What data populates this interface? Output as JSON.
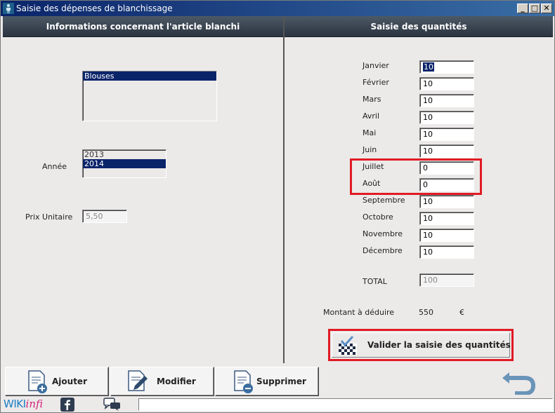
{
  "window": {
    "title": "Saisie des dépenses de blanchissage",
    "min_glyph": "_",
    "max_glyph": "□",
    "close_glyph": "✕"
  },
  "left_panel": {
    "header": "Informations concernant l'article blanchi",
    "article_list": [
      "Blouses"
    ],
    "article_selected": "Blouses",
    "annee_label": "Année",
    "annee_list": [
      "2013",
      "2014"
    ],
    "annee_selected": "2014",
    "prix_label": "Prix Unitaire",
    "prix_value": "5,50"
  },
  "right_panel": {
    "header": "Saisie des quantités",
    "months": [
      {
        "label": "Janvier",
        "value": "10"
      },
      {
        "label": "Février",
        "value": "10"
      },
      {
        "label": "Mars",
        "value": "10"
      },
      {
        "label": "Avril",
        "value": "10"
      },
      {
        "label": "Mai",
        "value": "10"
      },
      {
        "label": "Juin",
        "value": "10"
      },
      {
        "label": "Juillet",
        "value": "0"
      },
      {
        "label": "Août",
        "value": "0"
      },
      {
        "label": "Septembre",
        "value": "10"
      },
      {
        "label": "Octobre",
        "value": "10"
      },
      {
        "label": "Novembre",
        "value": "10"
      },
      {
        "label": "Décembre",
        "value": "10"
      }
    ],
    "total_label": "TOTAL",
    "total_value": "100",
    "montant_label": "Montant à déduire",
    "montant_value": "550",
    "montant_currency": "€",
    "validate_label": "Valider la saisie des quantités"
  },
  "toolbar": {
    "ajouter_label": "Ajouter",
    "modifier_label": "Modifier",
    "supprimer_label": "Supprimer"
  },
  "statusbar": {
    "logo_part1": "WIKI",
    "logo_part2": "infi",
    "facebook_glyph": "f"
  },
  "colors": {
    "header_bg": "#2b3440",
    "selection": "#0a246a",
    "highlight": "#e01b24"
  }
}
